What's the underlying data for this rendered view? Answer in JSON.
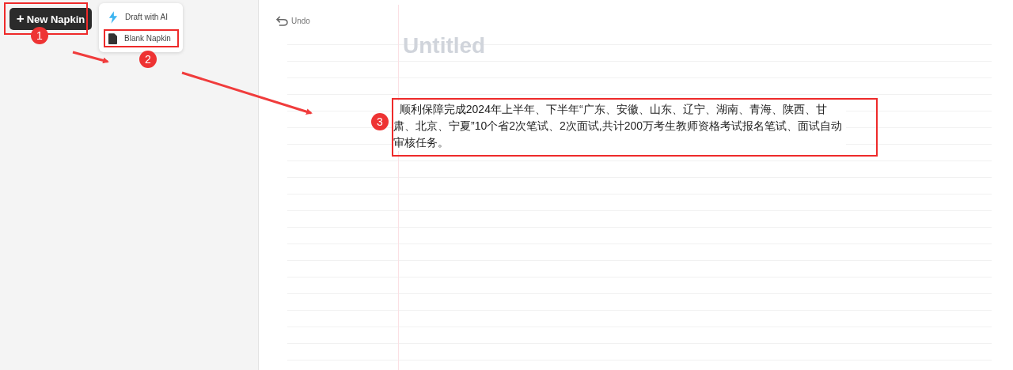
{
  "sidebar": {
    "new_button": {
      "icon": "+",
      "label": "New Napkin"
    },
    "menu": [
      {
        "kind": "ai",
        "label": "Draft with AI"
      },
      {
        "kind": "blank",
        "label": "Blank Napkin"
      }
    ]
  },
  "editor": {
    "undo": "Undo",
    "title": {
      "placeholder": "Untitled"
    },
    "body": "  顺利保障完成2024年上半年、下半年“广东、安徽、山东、辽宁、湖南、青海、陕西、甘肃、北京、宁夏”10个省2次笔试、2次面试,共计200万考生教师资格考试报名笔试、面试自动审核任务。"
  },
  "annotations": [
    {
      "label": "1"
    },
    {
      "label": "2"
    },
    {
      "label": "3"
    }
  ]
}
